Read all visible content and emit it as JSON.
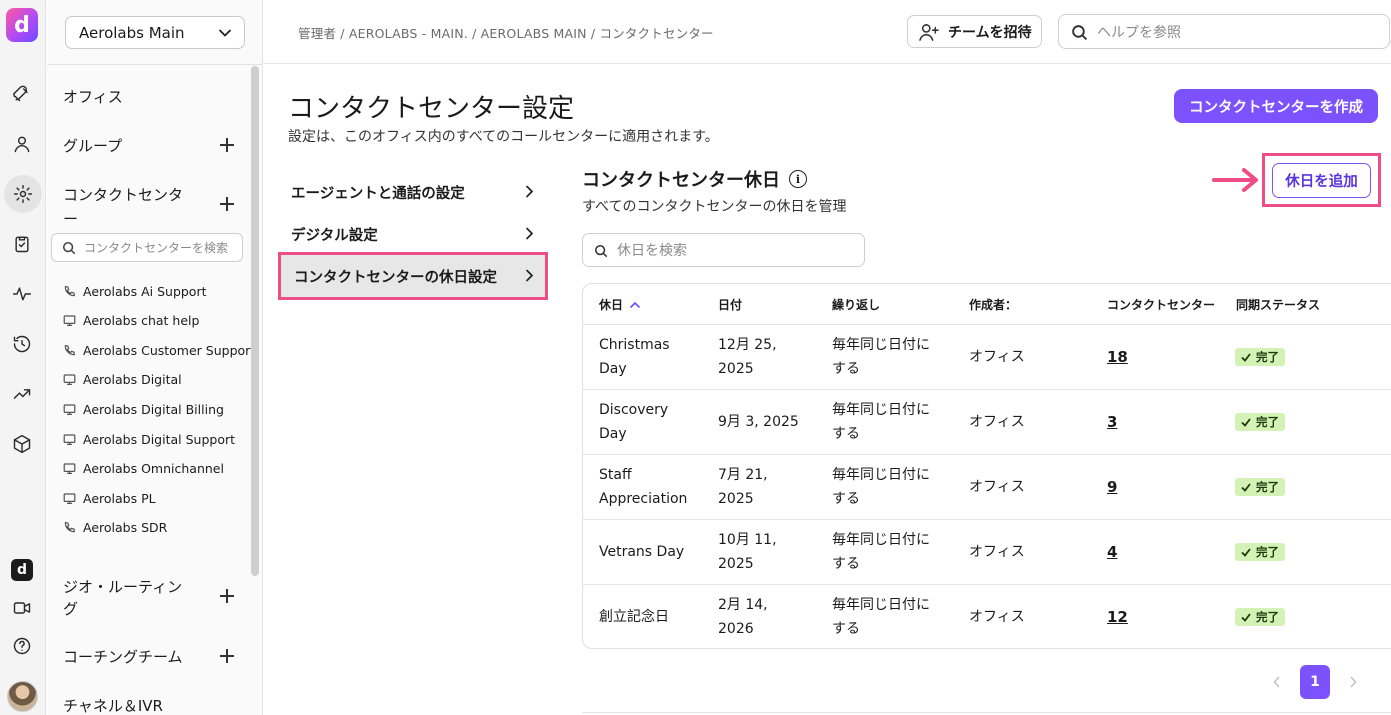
{
  "workspace": {
    "name": "Aerolabs Main"
  },
  "rail": {
    "logo_letter": "d",
    "mini_logo_letter": "d"
  },
  "sidebar": {
    "office": "オフィス",
    "groups": "グループ",
    "contact_center_line1": "コンタクトセンタ",
    "contact_center_line2": "ー",
    "search_placeholder": "コンタクトセンターを検索",
    "items": [
      {
        "label": "Aerolabs Ai Support",
        "icon": "phone-icon"
      },
      {
        "label": "Aerolabs chat help",
        "icon": "monitor-icon"
      },
      {
        "label": "Aerolabs Customer Support",
        "icon": "phone-icon"
      },
      {
        "label": "Aerolabs Digital",
        "icon": "monitor-icon"
      },
      {
        "label": "Aerolabs Digital Billing",
        "icon": "monitor-icon"
      },
      {
        "label": "Aerolabs Digital Support",
        "icon": "monitor-icon"
      },
      {
        "label": "Aerolabs Omnichannel",
        "icon": "monitor-icon"
      },
      {
        "label": "Aerolabs PL",
        "icon": "monitor-icon"
      },
      {
        "label": "Aerolabs SDR",
        "icon": "phone-icon"
      }
    ],
    "geo_routing_line1": "ジオ・ルーティン",
    "geo_routing_line2": "グ",
    "coaching": "コーチングチーム",
    "channel_ivr": "チャネル＆IVR"
  },
  "header": {
    "breadcrumb": "管理者 / AEROLABS - MAIN. / AEROLABS MAIN / コンタクトセンター",
    "invite_label": "チームを招待",
    "help_placeholder": "ヘルプを参照"
  },
  "main": {
    "title": "コンタクトセンター設定",
    "subtitle": "設定は、このオフィス内のすべてのコールセンターに適用されます。",
    "create_button": "コンタクトセンターを作成",
    "subnav": [
      "エージェントと通話の設定",
      "デジタル設定",
      "コンタクトセンターの休日設定"
    ],
    "section_title": "コンタクトセンター休日",
    "section_info": "i",
    "section_sub": "すべてのコンタクトセンターの休日を管理",
    "add_button": "休日を追加",
    "search_placeholder": "休日を検索"
  },
  "table": {
    "columns": [
      "休日",
      "日付",
      "繰り返し",
      "作成者：",
      "コンタクトセンター",
      "同期ステータス"
    ],
    "rows": [
      {
        "holiday1": "Christmas",
        "holiday2": "Day",
        "date1": "12月 25,",
        "date2": "2025",
        "repeat1": "毎年同じ日付に",
        "repeat2": "する",
        "creator": "オフィス",
        "count": "18",
        "status": "完了"
      },
      {
        "holiday1": "Discovery",
        "holiday2": "Day",
        "date1": "9月 3, 2025",
        "date2": "",
        "repeat1": "毎年同じ日付に",
        "repeat2": "する",
        "creator": "オフィス",
        "count": "3",
        "status": "完了"
      },
      {
        "holiday1": "Staff",
        "holiday2": "Appreciation",
        "date1": "7月 21,",
        "date2": "2025",
        "repeat1": "毎年同じ日付に",
        "repeat2": "する",
        "creator": "オフィス",
        "count": "9",
        "status": "完了"
      },
      {
        "holiday1": "Vetrans Day",
        "holiday2": "",
        "date1": "10月 11,",
        "date2": "2025",
        "repeat1": "毎年同じ日付に",
        "repeat2": "する",
        "creator": "オフィス",
        "count": "4",
        "status": "完了"
      },
      {
        "holiday1": "創立記念日",
        "holiday2": "",
        "date1": "2月 14,",
        "date2": "2026",
        "repeat1": "毎年同じ日付に",
        "repeat2": "する",
        "creator": "オフィス",
        "count": "12",
        "status": "完了"
      }
    ]
  },
  "pagination": {
    "current": "1"
  },
  "colors": {
    "accent": "#7c52ff",
    "highlight": "#ee4d86",
    "status_bg": "#d4f2b6"
  }
}
